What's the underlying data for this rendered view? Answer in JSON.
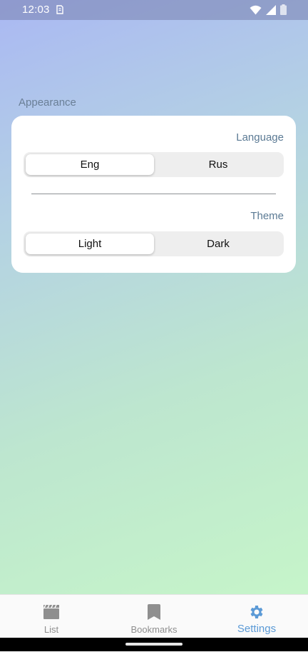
{
  "status_bar": {
    "time": "12:03",
    "icons": [
      "sim-card-icon",
      "wifi-icon",
      "signal-icon",
      "battery-icon"
    ]
  },
  "section": {
    "title": "Appearance"
  },
  "settings": {
    "language": {
      "label": "Language",
      "options": [
        "Eng",
        "Rus"
      ],
      "selected": "Eng"
    },
    "theme": {
      "label": "Theme",
      "options": [
        "Light",
        "Dark"
      ],
      "selected": "Light"
    }
  },
  "bottom_nav": {
    "items": [
      {
        "label": "List",
        "icon": "clapperboard-icon",
        "active": false
      },
      {
        "label": "Bookmarks",
        "icon": "bookmark-icon",
        "active": false
      },
      {
        "label": "Settings",
        "icon": "gear-icon",
        "active": true
      }
    ]
  },
  "colors": {
    "accent": "#5b9ad6",
    "label": "#5b7a94",
    "inactive_nav": "#8f8f8f"
  }
}
